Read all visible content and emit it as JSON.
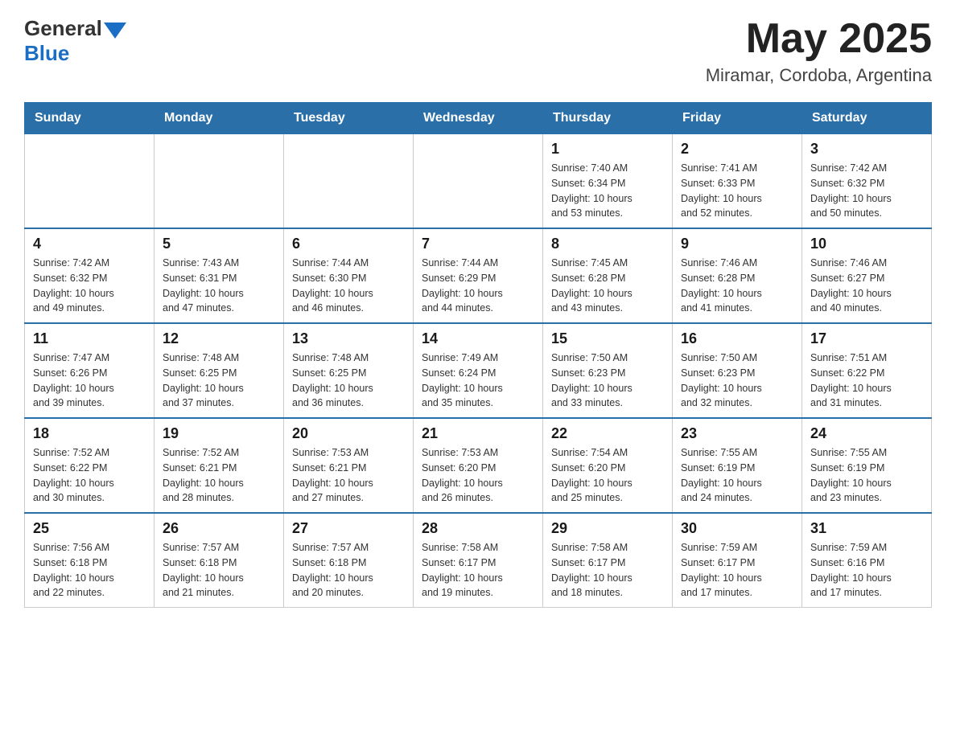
{
  "header": {
    "logo_general": "General",
    "logo_blue": "Blue",
    "month_title": "May 2025",
    "location": "Miramar, Cordoba, Argentina"
  },
  "weekdays": [
    "Sunday",
    "Monday",
    "Tuesday",
    "Wednesday",
    "Thursday",
    "Friday",
    "Saturday"
  ],
  "weeks": [
    [
      {
        "day": "",
        "info": ""
      },
      {
        "day": "",
        "info": ""
      },
      {
        "day": "",
        "info": ""
      },
      {
        "day": "",
        "info": ""
      },
      {
        "day": "1",
        "info": "Sunrise: 7:40 AM\nSunset: 6:34 PM\nDaylight: 10 hours\nand 53 minutes."
      },
      {
        "day": "2",
        "info": "Sunrise: 7:41 AM\nSunset: 6:33 PM\nDaylight: 10 hours\nand 52 minutes."
      },
      {
        "day": "3",
        "info": "Sunrise: 7:42 AM\nSunset: 6:32 PM\nDaylight: 10 hours\nand 50 minutes."
      }
    ],
    [
      {
        "day": "4",
        "info": "Sunrise: 7:42 AM\nSunset: 6:32 PM\nDaylight: 10 hours\nand 49 minutes."
      },
      {
        "day": "5",
        "info": "Sunrise: 7:43 AM\nSunset: 6:31 PM\nDaylight: 10 hours\nand 47 minutes."
      },
      {
        "day": "6",
        "info": "Sunrise: 7:44 AM\nSunset: 6:30 PM\nDaylight: 10 hours\nand 46 minutes."
      },
      {
        "day": "7",
        "info": "Sunrise: 7:44 AM\nSunset: 6:29 PM\nDaylight: 10 hours\nand 44 minutes."
      },
      {
        "day": "8",
        "info": "Sunrise: 7:45 AM\nSunset: 6:28 PM\nDaylight: 10 hours\nand 43 minutes."
      },
      {
        "day": "9",
        "info": "Sunrise: 7:46 AM\nSunset: 6:28 PM\nDaylight: 10 hours\nand 41 minutes."
      },
      {
        "day": "10",
        "info": "Sunrise: 7:46 AM\nSunset: 6:27 PM\nDaylight: 10 hours\nand 40 minutes."
      }
    ],
    [
      {
        "day": "11",
        "info": "Sunrise: 7:47 AM\nSunset: 6:26 PM\nDaylight: 10 hours\nand 39 minutes."
      },
      {
        "day": "12",
        "info": "Sunrise: 7:48 AM\nSunset: 6:25 PM\nDaylight: 10 hours\nand 37 minutes."
      },
      {
        "day": "13",
        "info": "Sunrise: 7:48 AM\nSunset: 6:25 PM\nDaylight: 10 hours\nand 36 minutes."
      },
      {
        "day": "14",
        "info": "Sunrise: 7:49 AM\nSunset: 6:24 PM\nDaylight: 10 hours\nand 35 minutes."
      },
      {
        "day": "15",
        "info": "Sunrise: 7:50 AM\nSunset: 6:23 PM\nDaylight: 10 hours\nand 33 minutes."
      },
      {
        "day": "16",
        "info": "Sunrise: 7:50 AM\nSunset: 6:23 PM\nDaylight: 10 hours\nand 32 minutes."
      },
      {
        "day": "17",
        "info": "Sunrise: 7:51 AM\nSunset: 6:22 PM\nDaylight: 10 hours\nand 31 minutes."
      }
    ],
    [
      {
        "day": "18",
        "info": "Sunrise: 7:52 AM\nSunset: 6:22 PM\nDaylight: 10 hours\nand 30 minutes."
      },
      {
        "day": "19",
        "info": "Sunrise: 7:52 AM\nSunset: 6:21 PM\nDaylight: 10 hours\nand 28 minutes."
      },
      {
        "day": "20",
        "info": "Sunrise: 7:53 AM\nSunset: 6:21 PM\nDaylight: 10 hours\nand 27 minutes."
      },
      {
        "day": "21",
        "info": "Sunrise: 7:53 AM\nSunset: 6:20 PM\nDaylight: 10 hours\nand 26 minutes."
      },
      {
        "day": "22",
        "info": "Sunrise: 7:54 AM\nSunset: 6:20 PM\nDaylight: 10 hours\nand 25 minutes."
      },
      {
        "day": "23",
        "info": "Sunrise: 7:55 AM\nSunset: 6:19 PM\nDaylight: 10 hours\nand 24 minutes."
      },
      {
        "day": "24",
        "info": "Sunrise: 7:55 AM\nSunset: 6:19 PM\nDaylight: 10 hours\nand 23 minutes."
      }
    ],
    [
      {
        "day": "25",
        "info": "Sunrise: 7:56 AM\nSunset: 6:18 PM\nDaylight: 10 hours\nand 22 minutes."
      },
      {
        "day": "26",
        "info": "Sunrise: 7:57 AM\nSunset: 6:18 PM\nDaylight: 10 hours\nand 21 minutes."
      },
      {
        "day": "27",
        "info": "Sunrise: 7:57 AM\nSunset: 6:18 PM\nDaylight: 10 hours\nand 20 minutes."
      },
      {
        "day": "28",
        "info": "Sunrise: 7:58 AM\nSunset: 6:17 PM\nDaylight: 10 hours\nand 19 minutes."
      },
      {
        "day": "29",
        "info": "Sunrise: 7:58 AM\nSunset: 6:17 PM\nDaylight: 10 hours\nand 18 minutes."
      },
      {
        "day": "30",
        "info": "Sunrise: 7:59 AM\nSunset: 6:17 PM\nDaylight: 10 hours\nand 17 minutes."
      },
      {
        "day": "31",
        "info": "Sunrise: 7:59 AM\nSunset: 6:16 PM\nDaylight: 10 hours\nand 17 minutes."
      }
    ]
  ]
}
